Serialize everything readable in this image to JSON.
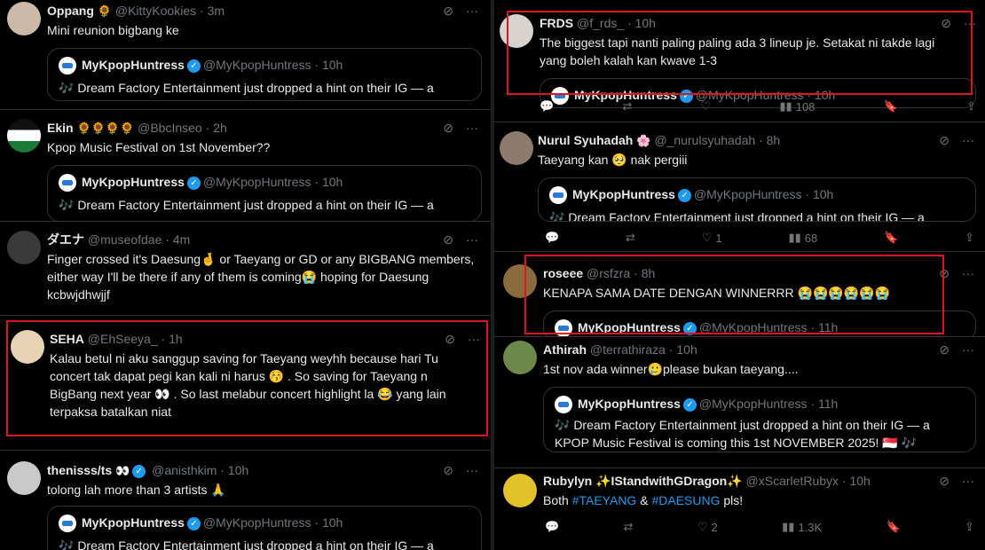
{
  "quoted": {
    "name": "MyKpopHuntress",
    "handle": "@MyKpopHuntress",
    "text_line1": "🎶 Dream Factory Entertainment just dropped a hint on their IG — a",
    "text_line2": "KPOP Music Festival is coming this 1st NOVEMBER 2025! 🇸🇬 🎶"
  },
  "left_tweets": [
    {
      "name": "Oppang",
      "badges": "🌻",
      "handle": "@KittyKookies",
      "time": "3m",
      "text": [
        "Mini reunion bigbang ke"
      ],
      "quote_time": "10h"
    },
    {
      "name": "Ekin",
      "badges": "🌻🌻🌻🌻",
      "handle": "@BbcInseo",
      "time": "2h",
      "text": [
        "Kpop Music Festival on 1st November??"
      ],
      "quote_time": "10h"
    },
    {
      "name": "ダエナ",
      "badges": "",
      "handle": "@museofdae",
      "time": "4m",
      "text": [
        "Finger crossed it's Daesung🤞 or Taeyang or GD or any BIGBANG members,",
        "either way I'll be there if any of them is coming😭 hoping for Daesung",
        "kcbwjdhwjjf"
      ]
    },
    {
      "name": "SEHA",
      "badges": "",
      "handle": "@EhSeeya_",
      "time": "1h",
      "text": [
        "Kalau betul ni aku sanggup saving for Taeyang weyhh because hari Tu",
        "concert tak dapat pegi kan kali ni harus 😚 . So saving for Taeyang n",
        "BigBang next year 👀 . So last melabur concert highlight la 😂 yang lain",
        "terpaksa batalkan niat"
      ]
    },
    {
      "name": "thenisss/ts",
      "badges": "👀",
      "handle": "@anisthkim",
      "time": "10h",
      "text": [
        "tolong lah more than 3 artists 🙏"
      ],
      "quote_time": "10h"
    }
  ],
  "right_tweets": [
    {
      "name": "FRDS",
      "badges": "",
      "handle": "@f_rds_",
      "time": "10h",
      "text": [
        "The biggest tapi nanti paling paling ada 3 lineup je. Setakat ni takde lagi",
        "yang boleh kalah kan kwave 1-3"
      ],
      "quote_time": "10h",
      "views": "108"
    },
    {
      "name": "Nurul Syuhadah",
      "badges": "🌸",
      "handle": "@_nurulsyuhadah",
      "time": "8h",
      "text": [
        "Taeyang kan 🥺 nak pergiii"
      ],
      "quote_time": "10h",
      "likes": "1",
      "views": "68"
    },
    {
      "name": "roseee",
      "badges": "",
      "handle": "@rsfzra",
      "time": "8h",
      "text": [
        "KENAPA SAMA DATE DENGAN WINNERRR 😭😭😭😭😭😭"
      ],
      "quote_time": "11h"
    },
    {
      "name": "Athirah",
      "badges": "",
      "handle": "@terrathiraza",
      "time": "10h",
      "text": [
        "1st nov ada winner🥲please bukan taeyang...."
      ],
      "quote_time": "11h"
    },
    {
      "name": "Rubylyn",
      "badges": "✨IStandwithGDragon✨",
      "handle": "@xScarletRubyx",
      "time": "10h",
      "text_prefix": "Both ",
      "hashtag1": "#TAEYANG",
      "text_mid": " & ",
      "hashtag2": "#DAESUNG",
      "text_suffix": " pls!",
      "likes": "2",
      "views": "1.3K"
    }
  ],
  "icons": {
    "grok": "grok-icon",
    "more": "more-icon",
    "reply": "reply-icon",
    "retweet": "retweet-icon",
    "like": "like-icon",
    "views": "views-icon",
    "bookmark": "bookmark-icon",
    "share": "share-icon"
  },
  "colors": {
    "background": "#000000",
    "text": "#e7e9ea",
    "muted": "#71767b",
    "link": "#1d9bf0",
    "highlight": "#e0141b"
  }
}
